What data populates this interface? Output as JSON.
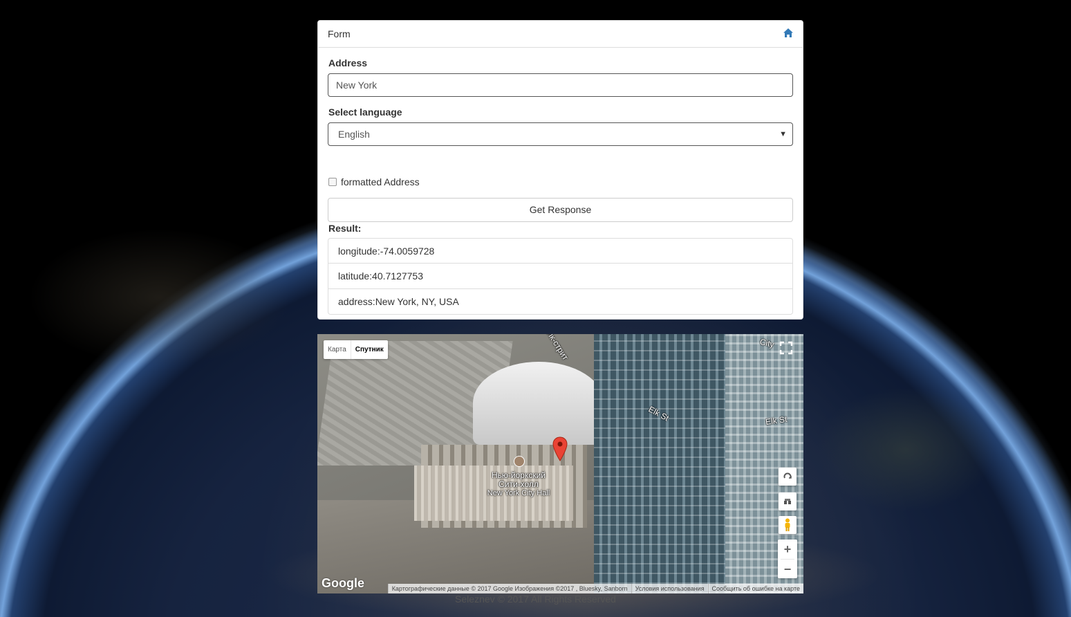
{
  "form": {
    "title": "Form",
    "address_label": "Address",
    "address_value": "New York",
    "language_label": "Select language",
    "language_value": "English",
    "formatted_label": "formatted Address",
    "formatted_checked": false,
    "button_label": "Get Response",
    "result_label": "Result:",
    "results": [
      "longitude:-74.0059728",
      "latitude:40.7127753",
      "address:New York, NY, USA"
    ]
  },
  "map": {
    "type_buttons": [
      "Карта",
      "Спутник"
    ],
    "active_type": "Спутник",
    "streets": [
      "Элк-стрит",
      "Elk St",
      "Elk St",
      "City"
    ],
    "poi": [
      "Нью-йоркский",
      "Сити-холл",
      "New York City Hall"
    ],
    "logo": "Google",
    "attribution": [
      "Картографические данные © 2017 Google Изображения ©2017 , Bluesky, Sanborn",
      "Условия использования",
      "Сообщить об ошибке на карте"
    ],
    "zoom_in": "+",
    "zoom_out": "−"
  },
  "footer": "Seleznev © 2017 All Rights Reserved",
  "colors": {
    "accent": "#337ab7",
    "marker": "#ea4335"
  }
}
